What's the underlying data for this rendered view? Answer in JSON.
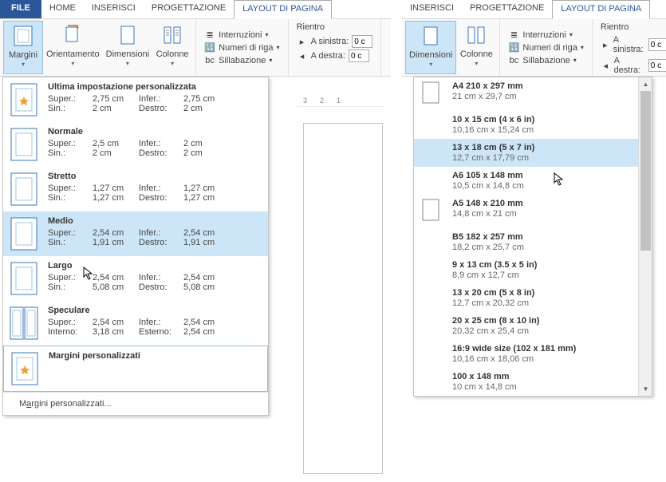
{
  "tabsLeft": [
    "FILE",
    "HOME",
    "INSERISCI",
    "PROGETTAZIONE",
    "LAYOUT DI PAGINA"
  ],
  "tabsRight": [
    "INSERISCI",
    "PROGETTAZIONE",
    "LAYOUT DI PAGINA"
  ],
  "ribbon": {
    "margini": "Margini",
    "orientamento": "Orientamento",
    "dimensioni": "Dimensioni",
    "colonne": "Colonne",
    "interruzioni": "Interruzioni",
    "numeriRiga": "Numeri di riga",
    "sillabazione": "Sillabazione",
    "rientro": "Rientro",
    "aSinistra": "A sinistra:",
    "aDestra": "A destra:",
    "valSinistra": "0 c",
    "valDestra": "0 c"
  },
  "marginOptions": [
    {
      "title": "Ultima impostazione personalizzata",
      "rows": [
        [
          "Super.:",
          "2,75 cm",
          "Infer.:",
          "2,75 cm"
        ],
        [
          "Sin.:",
          "2 cm",
          "Destro:",
          "2 cm"
        ]
      ],
      "star": true
    },
    {
      "title": "Normale",
      "rows": [
        [
          "Super.:",
          "2,5 cm",
          "Infer.:",
          "2 cm"
        ],
        [
          "Sin.:",
          "2 cm",
          "Destro:",
          "2 cm"
        ]
      ]
    },
    {
      "title": "Stretto",
      "rows": [
        [
          "Super.:",
          "1,27 cm",
          "Infer.:",
          "1,27 cm"
        ],
        [
          "Sin.:",
          "1,27 cm",
          "Destro:",
          "1,27 cm"
        ]
      ]
    },
    {
      "title": "Medio",
      "rows": [
        [
          "Super.:",
          "2,54 cm",
          "Infer.:",
          "2,54 cm"
        ],
        [
          "Sin.:",
          "1,91 cm",
          "Destro:",
          "1,91 cm"
        ]
      ],
      "hover": true
    },
    {
      "title": "Largo",
      "rows": [
        [
          "Super.:",
          "2,54 cm",
          "Infer.:",
          "2,54 cm"
        ],
        [
          "Sin.:",
          "5,08 cm",
          "Destro:",
          "5,08 cm"
        ]
      ]
    },
    {
      "title": "Speculare",
      "rows": [
        [
          "Super.:",
          "2,54 cm",
          "Infer.:",
          "2,54 cm"
        ],
        [
          "Interno:",
          "3,18 cm",
          "Esterno:",
          "2,54 cm"
        ]
      ]
    },
    {
      "title": "Margini personalizzati",
      "rows": [],
      "star": true,
      "border": true
    }
  ],
  "marginFooter": {
    "pre": "M",
    "u": "a",
    "post": "rgini personalizzati..."
  },
  "dimOptions": [
    {
      "title": "A4 210 x 297 mm",
      "sub": "21 cm x 29,7 cm",
      "icon": true
    },
    {
      "title": "10 x 15 cm (4 x 6 in)",
      "sub": "10,16 cm x 15,24 cm"
    },
    {
      "title": "13 x 18 cm (5 x 7 in)",
      "sub": "12,7 cm x 17,79 cm",
      "hover": true,
      "cursor": true
    },
    {
      "title": "A6 105 x 148 mm",
      "sub": "10,5 cm x 14,8 cm"
    },
    {
      "title": "A5 148 x 210 mm",
      "sub": "14,8 cm x 21 cm",
      "icon": true
    },
    {
      "title": "B5 182 x 257 mm",
      "sub": "18,2 cm x 25,7 cm"
    },
    {
      "title": "9 x 13 cm (3.5 x 5 in)",
      "sub": "8,9 cm x 12,7 cm"
    },
    {
      "title": "13 x 20 cm (5 x 8 in)",
      "sub": "12,7 cm x 20,32 cm"
    },
    {
      "title": "20 x 25 cm (8 x 10 in)",
      "sub": "20,32 cm x 25,4 cm"
    },
    {
      "title": "16:9 wide size (102 x 181 mm)",
      "sub": "10,16 cm x 18,06 cm"
    },
    {
      "title": "100 x 148 mm",
      "sub": "10 cm x 14,8 cm"
    }
  ],
  "rulerMarks": [
    "3",
    "2",
    "1"
  ]
}
